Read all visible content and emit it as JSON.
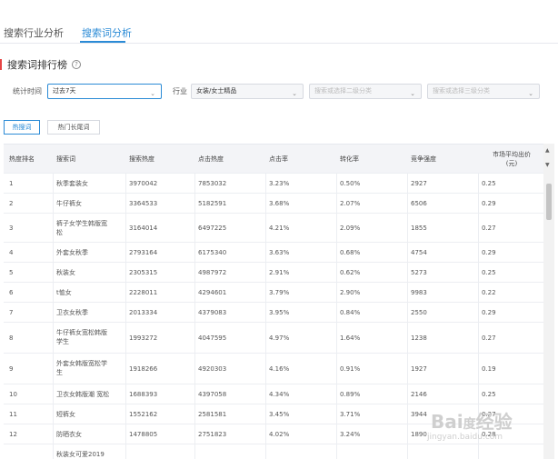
{
  "tabs": [
    {
      "label": "搜索行业分析"
    },
    {
      "label": "搜索词分析"
    }
  ],
  "section": {
    "title": "搜索词排行榜",
    "help": "?"
  },
  "filters": {
    "time_label": "统计时间",
    "time_value": "过去7天",
    "industry_label": "行业",
    "industry_value": "女装/女士精品",
    "second_placeholder": "搜索或选择二级分类",
    "third_placeholder": "搜索或选择三级分类"
  },
  "toggles": [
    "热搜词",
    "热门长尾词"
  ],
  "table": {
    "headers": [
      "热度排名",
      "搜索词",
      "搜索热度",
      "点击热度",
      "点击率",
      "转化率",
      "竞争强度",
      "市场平均出价\n(元)"
    ],
    "rows": [
      {
        "rank": "1",
        "term": "秋季套装女",
        "search": "3970042",
        "click": "7853032",
        "ctr": "3.23%",
        "cvr": "0.50%",
        "comp": "2927",
        "price": "0.25"
      },
      {
        "rank": "2",
        "term": "牛仔裤女",
        "search": "3364533",
        "click": "5182591",
        "ctr": "3.68%",
        "cvr": "2.07%",
        "comp": "6506",
        "price": "0.29"
      },
      {
        "rank": "3",
        "term": "裤子女学生韩版宽松",
        "search": "3164014",
        "click": "6497225",
        "ctr": "4.21%",
        "cvr": "2.09%",
        "comp": "1855",
        "price": "0.27"
      },
      {
        "rank": "4",
        "term": "外套女秋季",
        "search": "2793164",
        "click": "6175340",
        "ctr": "3.63%",
        "cvr": "0.68%",
        "comp": "4754",
        "price": "0.29"
      },
      {
        "rank": "5",
        "term": "秋装女",
        "search": "2305315",
        "click": "4987972",
        "ctr": "2.91%",
        "cvr": "0.62%",
        "comp": "5273",
        "price": "0.25"
      },
      {
        "rank": "6",
        "term": "t恤女",
        "search": "2228011",
        "click": "4294601",
        "ctr": "3.79%",
        "cvr": "2.90%",
        "comp": "9983",
        "price": "0.22"
      },
      {
        "rank": "7",
        "term": "卫衣女秋季",
        "search": "2013334",
        "click": "4379083",
        "ctr": "3.95%",
        "cvr": "0.84%",
        "comp": "2550",
        "price": "0.29"
      },
      {
        "rank": "8",
        "term": "牛仔裤女宽松韩版学生",
        "search": "1993272",
        "click": "4047595",
        "ctr": "4.97%",
        "cvr": "1.64%",
        "comp": "1238",
        "price": "0.27"
      },
      {
        "rank": "9",
        "term": "外套女韩版宽松学生",
        "search": "1918266",
        "click": "4920303",
        "ctr": "4.16%",
        "cvr": "0.91%",
        "comp": "1927",
        "price": "0.19"
      },
      {
        "rank": "10",
        "term": "卫衣女韩版潮 宽松",
        "search": "1688393",
        "click": "4397058",
        "ctr": "4.34%",
        "cvr": "0.89%",
        "comp": "2146",
        "price": "0.25"
      },
      {
        "rank": "11",
        "term": "短裤女",
        "search": "1552162",
        "click": "2581581",
        "ctr": "3.45%",
        "cvr": "3.71%",
        "comp": "3944",
        "price": "0.27"
      },
      {
        "rank": "12",
        "term": "防晒衣女",
        "search": "1478805",
        "click": "2751823",
        "ctr": "4.02%",
        "cvr": "3.24%",
        "comp": "1890",
        "price": "0.28"
      },
      {
        "rank": "",
        "term": "秋装女可爱2019",
        "search": "",
        "click": "",
        "ctr": "",
        "cvr": "",
        "comp": "",
        "price": ""
      }
    ]
  },
  "watermark": {
    "logo": "Bai度经验",
    "url": "jingyan.baidu.com"
  }
}
